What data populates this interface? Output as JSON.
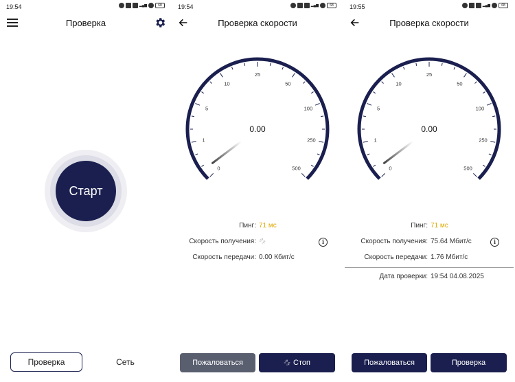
{
  "colors": {
    "primary": "#1a1f4f",
    "accent_ping": "#e0a800",
    "disabled_button": "#5a5f70"
  },
  "screens": [
    {
      "status": {
        "time": "19:54",
        "battery": "68"
      },
      "title": "Проверка",
      "start_label": "Старт",
      "nav": {
        "check": "Проверка",
        "network": "Сеть"
      }
    },
    {
      "status": {
        "time": "19:54",
        "battery": "68"
      },
      "title": "Проверка скорости",
      "gauge": {
        "value": "0.00",
        "ticks": [
          "0",
          "1",
          "5",
          "10",
          "25",
          "50",
          "100",
          "250",
          "500"
        ]
      },
      "ping_label": "Пинг:",
      "ping_value": "71 мс",
      "download_label": "Скорость получения:",
      "upload_label": "Скорость передачи:",
      "upload_value": "0.00 Кбит/с",
      "complain_label": "Пожаловаться",
      "stop_label": "Стоп"
    },
    {
      "status": {
        "time": "19:55",
        "battery": "68"
      },
      "title": "Проверка скорости",
      "gauge": {
        "value": "0.00",
        "ticks": [
          "0",
          "1",
          "5",
          "10",
          "25",
          "50",
          "100",
          "250",
          "500"
        ]
      },
      "ping_label": "Пинг:",
      "ping_value": "71 мс",
      "download_label": "Скорость получения:",
      "download_value": "75.64 Мбит/с",
      "upload_label": "Скорость передачи:",
      "upload_value": "1.76 Мбит/с",
      "date_label": "Дата проверки:",
      "date_value": "19:54 04.08.2025",
      "complain_label": "Пожаловаться",
      "check_label": "Проверка"
    }
  ]
}
